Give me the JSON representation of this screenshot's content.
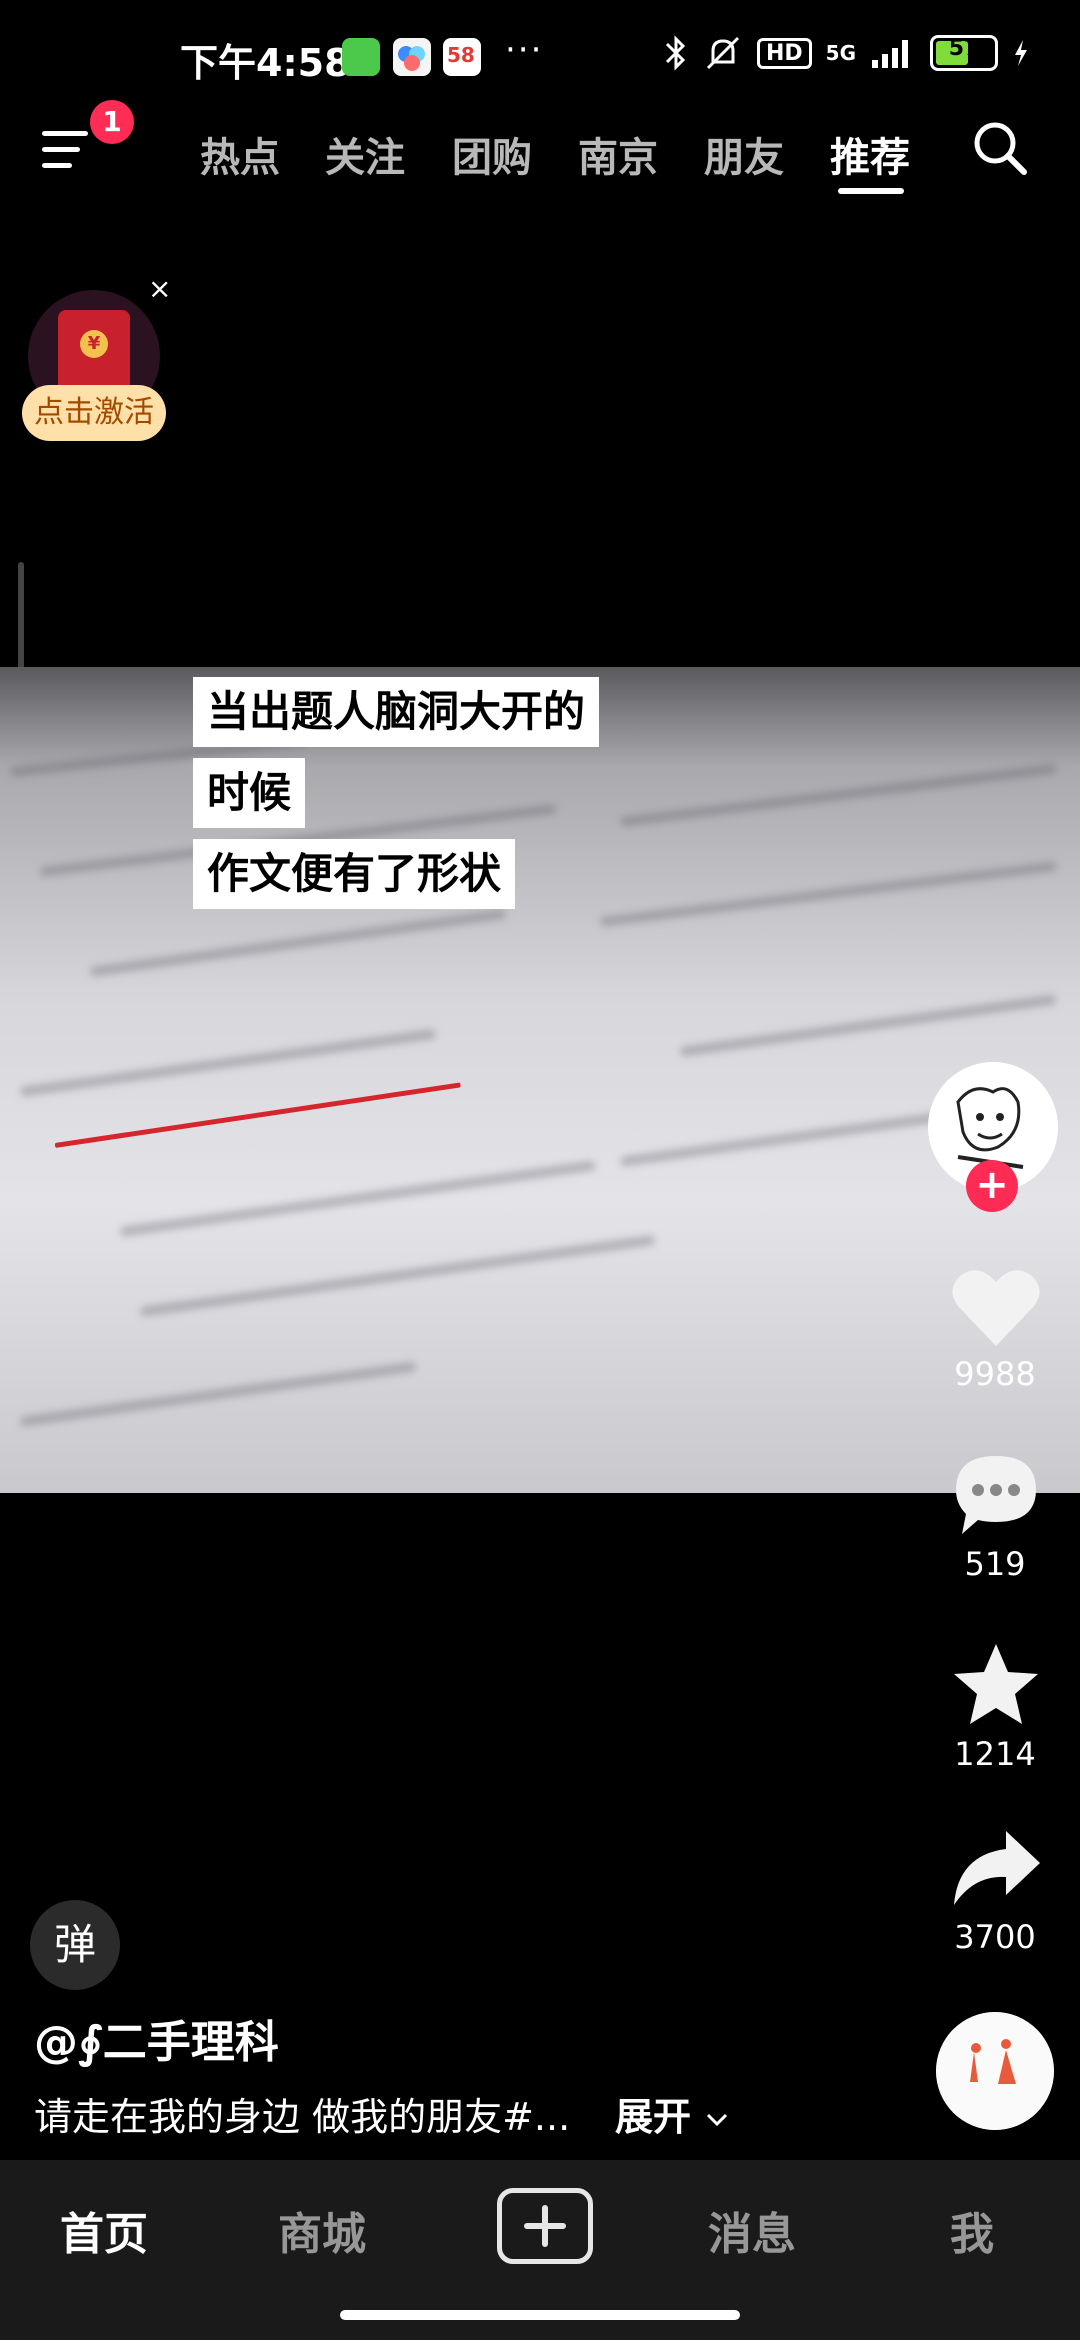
{
  "status_bar": {
    "time": "下午4:58",
    "more": "···",
    "network": "5G",
    "hd": "HD",
    "battery": "57",
    "battery_level_percent": 57
  },
  "top_nav": {
    "notification_badge": "1",
    "tabs": [
      {
        "label": "热点"
      },
      {
        "label": "关注"
      },
      {
        "label": "团购"
      },
      {
        "label": "南京"
      },
      {
        "label": "朋友"
      },
      {
        "label": "推荐",
        "active": true
      }
    ]
  },
  "red_packet": {
    "label": "点击激活",
    "close": "×",
    "coin": "¥"
  },
  "video": {
    "captions": [
      "当出题人脑洞大开的",
      "时候",
      "作文便有了形状"
    ]
  },
  "right_rail": {
    "follow": "+",
    "likes": "9988",
    "comments": "519",
    "favorites": "1214",
    "shares": "3700"
  },
  "bottom_info": {
    "danmu": "弹",
    "author": "@∮二手理科",
    "description": "请走在我的身边 做我的朋友#...",
    "expand": "展开"
  },
  "bottom_nav": {
    "items": [
      "首页",
      "商城",
      "消息",
      "我"
    ]
  },
  "colors": {
    "accent": "#fe2c55",
    "battery": "#7fdc3a",
    "underline": "#d6262d"
  }
}
